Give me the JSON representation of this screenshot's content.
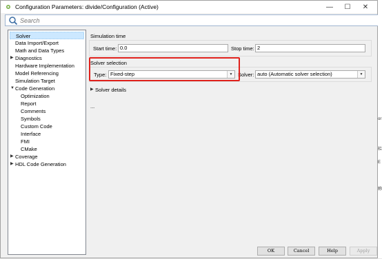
{
  "window": {
    "title": "Configuration Parameters: divide/Configuration (Active)",
    "controls": {
      "minimize": "—",
      "maximize": "☐",
      "close": "✕"
    }
  },
  "search": {
    "placeholder": "Search",
    "value": ""
  },
  "tree": {
    "items": [
      {
        "label": "Solver",
        "arrow": ""
      },
      {
        "label": "Data Import/Export",
        "arrow": ""
      },
      {
        "label": "Math and Data Types",
        "arrow": ""
      },
      {
        "label": "Diagnostics",
        "arrow": "▶"
      },
      {
        "label": "Hardware Implementation",
        "arrow": ""
      },
      {
        "label": "Model Referencing",
        "arrow": ""
      },
      {
        "label": "Simulation Target",
        "arrow": ""
      },
      {
        "label": "Code Generation",
        "arrow": "▼"
      },
      {
        "label": "Optimization",
        "arrow": ""
      },
      {
        "label": "Report",
        "arrow": ""
      },
      {
        "label": "Comments",
        "arrow": ""
      },
      {
        "label": "Symbols",
        "arrow": ""
      },
      {
        "label": "Custom Code",
        "arrow": ""
      },
      {
        "label": "Interface",
        "arrow": ""
      },
      {
        "label": "FMI",
        "arrow": ""
      },
      {
        "label": "CMake",
        "arrow": ""
      },
      {
        "label": "Coverage",
        "arrow": "▶"
      },
      {
        "label": "HDL Code Generation",
        "arrow": "▶"
      }
    ]
  },
  "simulation_time": {
    "title": "Simulation time",
    "start_label": "Start time:",
    "start_value": "0.0",
    "stop_label": "Stop time:",
    "stop_value": "2"
  },
  "solver_selection": {
    "title": "Solver selection",
    "type_label": "Type:",
    "type_value": "Fixed-step",
    "solver_label": "Solver:",
    "solver_value": "auto (Automatic solver selection)"
  },
  "solver_details": {
    "arrow": "▶",
    "label": "Solver details"
  },
  "ellipsis": "...",
  "footer": {
    "ok": "OK",
    "cancel": "Cancel",
    "help": "Help",
    "apply": "Apply"
  },
  "edge_chars": [
    "or",
    "栏",
    "E",
    "称"
  ],
  "colors": {
    "highlight": "#e0201b",
    "selection": "#cce8ff",
    "search_border": "#9fb4d0"
  }
}
